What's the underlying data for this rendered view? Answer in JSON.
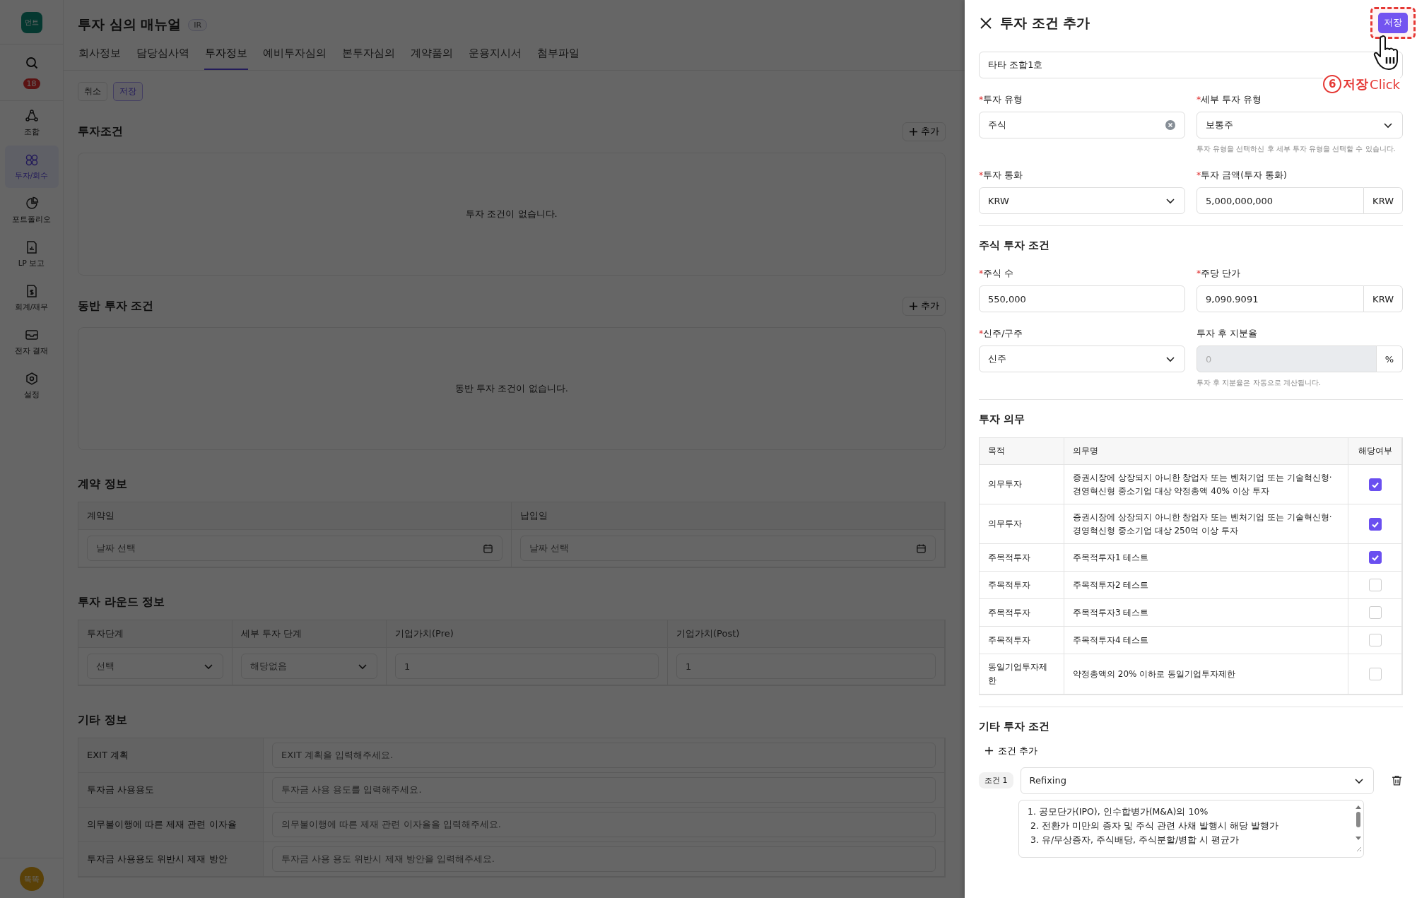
{
  "sidebar": {
    "logo": "먼트",
    "notification_count": "18",
    "items": [
      {
        "label": "조합",
        "selected": false
      },
      {
        "label": "투자/회수",
        "selected": true
      },
      {
        "label": "포트폴리오",
        "selected": false
      },
      {
        "label": "LP 보고",
        "selected": false
      },
      {
        "label": "회계/재무",
        "selected": false
      },
      {
        "label": "전자 결재",
        "selected": false
      },
      {
        "label": "설정",
        "selected": false
      }
    ],
    "avatar": "똑똑"
  },
  "page": {
    "title": "투자 심의 매뉴얼",
    "badge": "IR",
    "tabs": [
      {
        "label": "회사정보",
        "selected": false
      },
      {
        "label": "담당심사역",
        "selected": false
      },
      {
        "label": "투자정보",
        "selected": true
      },
      {
        "label": "예비투자심의",
        "selected": false
      },
      {
        "label": "본투자심의",
        "selected": false
      },
      {
        "label": "계약품의",
        "selected": false
      },
      {
        "label": "운용지시서",
        "selected": false
      },
      {
        "label": "첨부파일",
        "selected": false
      }
    ],
    "actions": [
      {
        "label": "취소",
        "kind": "plain"
      },
      {
        "label": "저장",
        "kind": "primary"
      }
    ],
    "investment_terms": {
      "title": "투자조건",
      "add_button": "추가",
      "empty_text": "투자 조건이 없습니다."
    },
    "co_investment_terms": {
      "title": "동반 투자 조건",
      "add_button": "추가",
      "empty_text": "동반 투자 조건이 없습니다."
    },
    "contract_info": {
      "title": "계약 정보",
      "fields": [
        {
          "label": "계약일",
          "placeholder": "날짜 선택"
        },
        {
          "label": "납입일",
          "placeholder": "날짜 선택"
        }
      ]
    },
    "round_info": {
      "title": "투자 라운드 정보",
      "fields": [
        {
          "label": "투자단계",
          "kind": "select",
          "placeholder": "선택"
        },
        {
          "label": "세부 투자 단계",
          "kind": "select",
          "placeholder": "해당없음"
        },
        {
          "label": "기업가치(Pre)",
          "kind": "input",
          "placeholder": "1"
        },
        {
          "label": "기업가치(Post)",
          "kind": "input",
          "placeholder": "1"
        }
      ]
    },
    "other_info": {
      "title": "기타 정보",
      "rows": [
        {
          "label": "EXIT 계획",
          "placeholder": "EXIT 계획을 입력해주세요."
        },
        {
          "label": "투자금 사용용도",
          "placeholder": "투자금 사용 용도를 입력해주세요."
        },
        {
          "label": "의무불이행에 따른 제재 관련 이자율",
          "placeholder": "의무불이행에 따른 제재 관련 이자율을 입력해주세요."
        },
        {
          "label": "투자금 사용용도 위반시 제재 방안",
          "placeholder": "투자금 사용 용도 위반시 제재 방안을 입력해주세요."
        }
      ]
    }
  },
  "drawer": {
    "title": "투자 조건 추가",
    "save_button": "저장",
    "required_symbol": "*",
    "annotation": {
      "number": "6",
      "label": "저장",
      "action": "Click"
    },
    "fund_value": "타타 조합1호",
    "basic_rows": [
      [
        {
          "label": "투자 유형",
          "required": true,
          "kind": "clearable",
          "value": "주식"
        },
        {
          "label": "세부 투자 유형",
          "required": true,
          "kind": "select",
          "value": "보통주",
          "helper": "투자 유형을 선택하신 후 세부 투자 유형을 선택할 수 있습니다."
        }
      ],
      [
        {
          "label": "투자 통화",
          "required": true,
          "kind": "select",
          "value": "KRW"
        },
        {
          "label": "투자 금액(투자 통화)",
          "required": true,
          "kind": "addon",
          "value": "5,000,000,000",
          "addon": "KRW",
          "disabled": false
        }
      ]
    ],
    "stock_title": "주식 투자 조건",
    "stock_rows": [
      [
        {
          "label": "주식 수",
          "required": true,
          "kind": "input",
          "value": "550,000"
        },
        {
          "label": "주당 단가",
          "required": true,
          "kind": "addon",
          "value": "9,090.9091",
          "addon": "KRW",
          "disabled": false
        }
      ],
      [
        {
          "label": "신주/구주",
          "required": true,
          "kind": "select",
          "value": "신주"
        },
        {
          "label": "투자 후 지분율",
          "required": false,
          "kind": "addon",
          "placeholder": "0",
          "addon": "%",
          "disabled": true,
          "helper": "투자 후 지분율은 자동으로 계산됩니다."
        }
      ]
    ],
    "obligations": {
      "title": "투자 의무",
      "columns": [
        "목적",
        "의무명",
        "해당여부"
      ],
      "rows": [
        {
          "purpose": "의무투자",
          "name": "증권시장에 상장되지 아니한 창업자 또는 벤처기업 또는 기술혁신형·경영혁신형 중소기업 대상 약정총액 40% 이상 투자",
          "checked": true
        },
        {
          "purpose": "의무투자",
          "name": "증권시장에 상장되지 아니한 창업자 또는 벤처기업 또는 기술혁신형·경영혁신형 중소기업 대상 250억 이상 투자",
          "checked": true
        },
        {
          "purpose": "주목적투자",
          "name": "주목적투자1 테스트",
          "checked": true
        },
        {
          "purpose": "주목적투자",
          "name": "주목적투자2 테스트",
          "checked": false
        },
        {
          "purpose": "주목적투자",
          "name": "주목적투자3 테스트",
          "checked": false
        },
        {
          "purpose": "주목적투자",
          "name": "주목적투자4 테스트",
          "checked": false
        },
        {
          "purpose": "동일기업투자제한",
          "name": "약정총액의 20% 이하로 동일기업투자제한",
          "checked": false
        }
      ]
    },
    "other_terms": {
      "title": "기타 투자 조건",
      "add_button": "조건 추가",
      "conditions": [
        {
          "label": "조건 1",
          "type": "Refixing",
          "description": "1. 공모단가(IPO), 인수합병가(M&A)의 10%\n 2. 전환가 미만의 증자 및 주식 관련 사채 발행시 해당 발행가\n 3. 유/무상증자, 주식배당, 주식분할/병합 시 평균가"
        }
      ]
    }
  }
}
